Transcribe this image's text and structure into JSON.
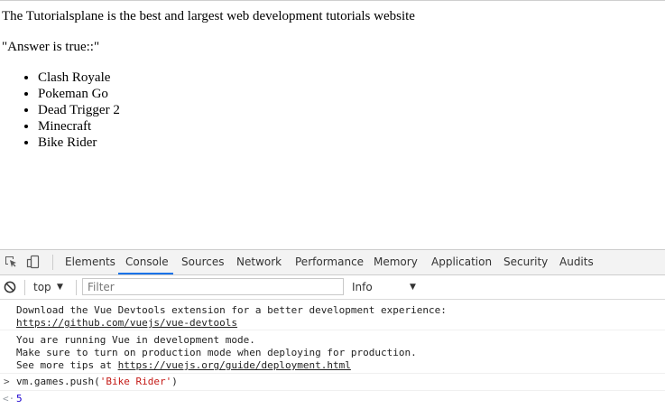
{
  "page": {
    "headline": "The Tutorialsplane is the best and largest web development tutorials website",
    "answer": "\"Answer is true::\"",
    "games": [
      "Clash Royale",
      "Pokeman Go",
      "Dead Trigger 2",
      "Minecraft",
      "Bike Rider"
    ]
  },
  "devtools": {
    "tabs": [
      {
        "label": "Elements"
      },
      {
        "label": "Console"
      },
      {
        "label": "Sources"
      },
      {
        "label": "Network"
      },
      {
        "label": "Performance"
      },
      {
        "label": "Memory"
      },
      {
        "label": "Application"
      },
      {
        "label": "Security"
      },
      {
        "label": "Audits"
      }
    ],
    "active_tab": "Console",
    "accent_color": "#1a73e8",
    "icons": {
      "inspect": "inspect-element-icon",
      "device": "device-toolbar-icon",
      "clear": "clear-console-icon"
    },
    "filter": {
      "context": "top",
      "placeholder": "Filter",
      "value": "",
      "level": "Info"
    },
    "console": {
      "devtools_msg": {
        "line1": "Download the Vue Devtools extension for a better development experience:",
        "link": "https://github.com/vuejs/vue-devtools"
      },
      "mode_msg": {
        "line1": "You are running Vue in development mode.",
        "line2": "Make sure to turn on production mode when deploying for production.",
        "line3_prefix": "See more tips at ",
        "link": "https://vuejs.org/guide/deployment.html"
      },
      "command": {
        "prefix": "vm.games.push(",
        "arg": "'Bike Rider'",
        "suffix": ")"
      },
      "result": "5"
    }
  }
}
